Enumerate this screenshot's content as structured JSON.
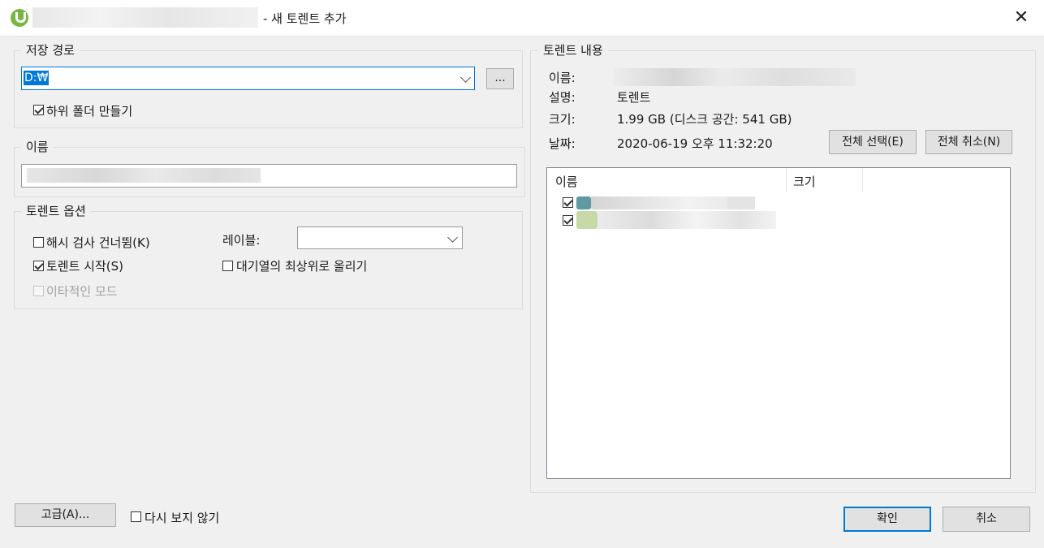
{
  "window": {
    "title_suffix": "- 새 토렌트 추가",
    "close_label": "✕"
  },
  "save_path": {
    "group_label": "저장 경로",
    "path_value": "D:₩",
    "browse_label": "...",
    "subfolder_label": "하위 폴더 만들기",
    "subfolder_checked": true
  },
  "name_group": {
    "group_label": "이름"
  },
  "options": {
    "group_label": "토렌트 옵션",
    "skip_hash_label": "해시 검사 건너뜀(K)",
    "start_label": "토렌트 시작(S)",
    "ethernet_label": "이타적인 모드",
    "label_label": "레이블:",
    "queue_top_label": "대기열의 최상위로 올리기"
  },
  "contents": {
    "group_label": "토렌트 내용",
    "name_key": "이름:",
    "desc_key": "설명:",
    "desc_value": "토렌트",
    "size_key": "크기:",
    "size_value": "1.99 GB (디스크 공간: 541 GB)",
    "date_key": "날짜:",
    "date_value": "2020-06-19 오후 11:32:20",
    "select_all_label": "전체 선택(E)",
    "deselect_all_label": "전체 취소(N)",
    "columns": [
      "이름",
      "크기"
    ]
  },
  "footer": {
    "advanced_label": "고급(A)...",
    "dont_show_label": "다시 보지 않기",
    "ok_label": "확인",
    "cancel_label": "취소"
  },
  "colors": {
    "accent": "#0078d7",
    "app_icon": "#76b83f"
  }
}
